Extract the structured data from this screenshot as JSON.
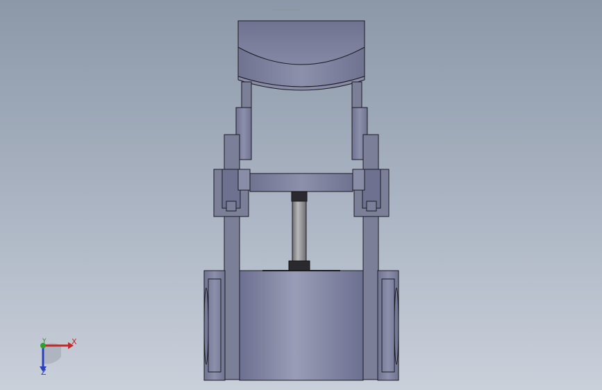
{
  "viewport": {
    "background_top": "#8c98a8",
    "background_bottom": "#c9d0da",
    "part_color": "#7c7f98",
    "part_edge": "#1a1a22",
    "shaft_color": "#9a9a9c"
  },
  "triad": {
    "x_label": "X",
    "y_label": "Y",
    "z_label": "Z",
    "x_color": "#c02a2a",
    "y_color": "#2ea02e",
    "z_color": "#2a3fc0"
  }
}
